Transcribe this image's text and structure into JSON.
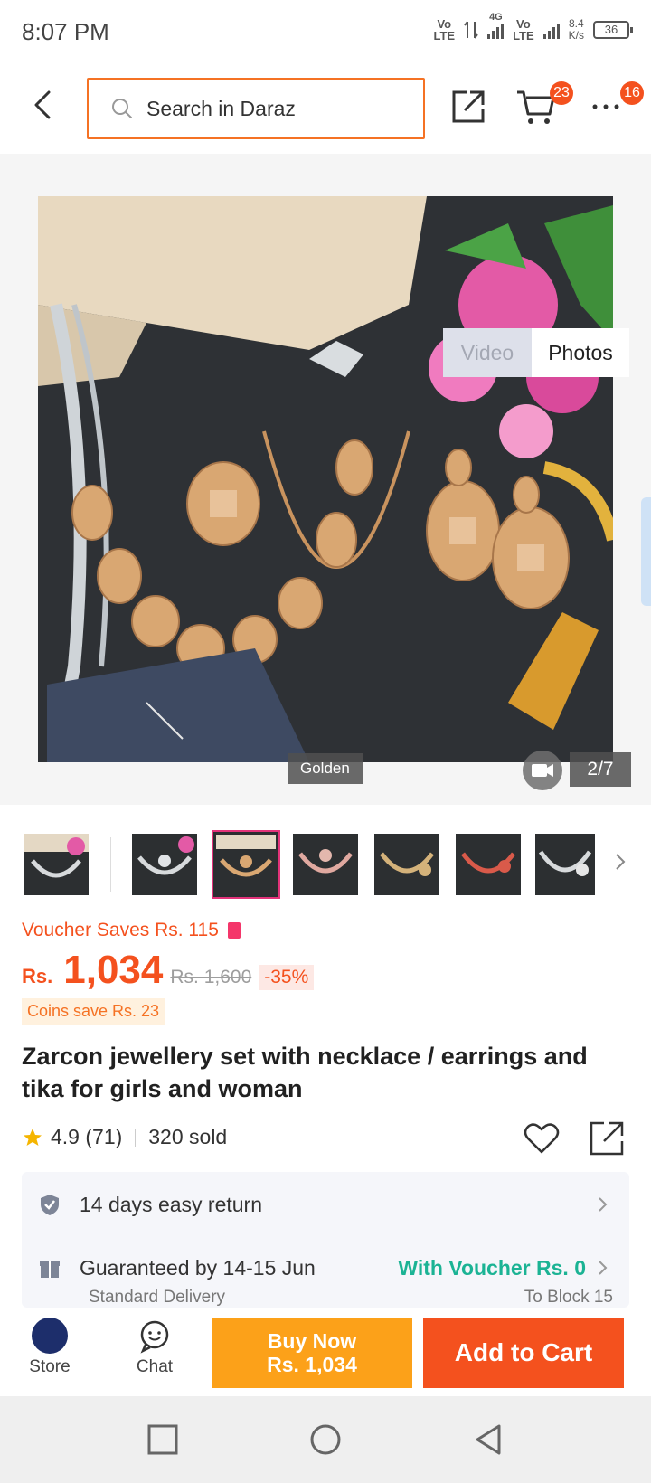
{
  "status_bar": {
    "time": "8:07 PM",
    "net1_top": "Vo",
    "net1_bottom": "LTE",
    "net2_top": "4G",
    "net3_top": "Vo",
    "net3_bottom": "LTE",
    "speed_top": "8.4",
    "speed_bottom": "K/s",
    "battery": "36"
  },
  "nav": {
    "search_placeholder": "Search in Daraz",
    "cart_badge": "23",
    "more_badge": "16",
    "accent": "#f57224"
  },
  "gallery": {
    "tab_video": "Video",
    "tab_photos": "Photos",
    "variant_label": "Golden",
    "counter": "2/7",
    "thumbnail_count": 7,
    "active_thumbnail": 3
  },
  "product": {
    "voucher_text": "Voucher Saves Rs. 115",
    "currency": "Rs.",
    "price": "1,034",
    "original_price": "Rs. 1,600",
    "discount": "-35%",
    "coins_text": "Coins save Rs. 23",
    "title": "Zarcon jewellery set with necklace / earrings and tika for girls and woman",
    "rating": "4.9 (71)",
    "sold": "320 sold"
  },
  "service": {
    "return_label": "14 days easy return",
    "delivery_label": "Guaranteed by 14-15 Jun",
    "voucher_label": "With Voucher Rs. 0",
    "delivery_type": "Standard Delivery",
    "delivery_to": "To Block 15"
  },
  "bottom_bar": {
    "store_label": "Store",
    "chat_label": "Chat",
    "buy_now_line1": "Buy Now",
    "buy_now_line2": "Rs. 1,034",
    "add_to_cart": "Add to Cart"
  }
}
